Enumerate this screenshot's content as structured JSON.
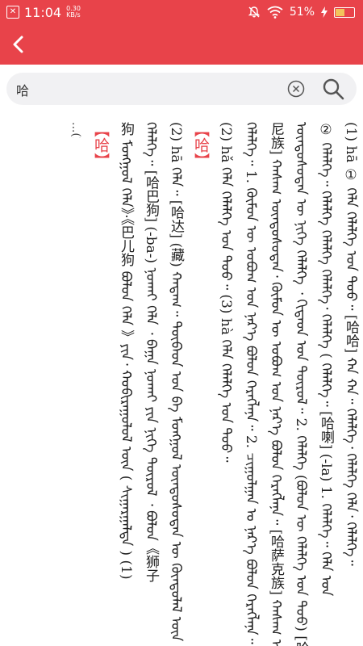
{
  "status_bar": {
    "time": "11:04",
    "net_speed_value": "0.30",
    "net_speed_unit": "KB/s",
    "battery": "51%",
    "battery_level": 0.51
  },
  "search": {
    "query": "哈"
  },
  "content": {
    "partial_top_line": "...(2) ...",
    "sections": [
      {
        "headword": "【哈】",
        "lines": [
          "狗 ᠮᠣᠩᠭᠤᠯ ᠬᠡᠯᠡ》·《巴儿狗 ᠪᠣᠯᠤᠨ ᠬᠡᠯᠡ 》ᠶᠢᠨ᠂ ᠬᠣᠪᠢᠷᠠᠭᠤᠯᠤᠯ ᠦᠨ ( ᠰᠢᠭᠠᠷᠭᠠᠯᠲᠠ ) ᠌(1)",
          "ᠬᠡᠯᠡᠯᠭᠡ᠃ [哈巴狗] (-ba-) ᠨᠣᠬᠠᠢ ᠬᠡᠯᠡ ᠂ ᠪᠠᠭᠠ ᠨᠣᠬᠠᠢ ᠶᠢᠨ ᠨᠢᠭᠡ ᠲᠦᠷᠦᠯ ᠂ ᠪᠣᠯᠤᠨ《狮子",
          "(2) hā ᠬᠡᠯᠡ᠃ [哈达] (藏) ᠬᠠᠳᠠᠭ᠃ ᠲᠦᠪᠡᠳ ᠤᠨ ᠪᠠ ᠮᠣᠩᠭᠤᠯ ᠦᠨᠳᠦᠰᠦᠲᠡᠨ ᠦ ᠬᠦᠨᠳᠦᠯᠡᠯ ᠦᠨ"
        ]
      },
      {
        "headword": "【哈】",
        "lines": [
          "(2) hǎ ᠬᠡᠯᠡ ᠬᠡᠯᠡᠯᠭᠡ ᠤᠨ ᠳᠤᠤ᠃ (3) hà ᠬᠡᠯᠡ ᠬᠡᠯᠡᠯᠭᠡ ᠤᠨ ᠳᠤᠤ᠃",
          "ᠬᠡᠯᠡᠯᠭᠡ᠃ 1. ᠬᠦᠮᠦᠨ ᠦ ᠣᠪᠣᠭ ᠤᠨ ᠨᠡᠷ᠎ᠡ ᠪᠣᠯᠤᠨ ᠬᠡᠷᠡᠭᠯᠡᠨᠡ᠃ 2. ᠴᠢᠭᠤᠯᠭᠠᠨ ᠤ ᠨᠡᠷ᠎ᠡ ᠪᠣᠯᠤᠨ ᠬᠡᠷᠡᠭᠯᠡᠨᠡ᠃",
          "尼族] ᠬᠠᠰᠠᠭ ᠦᠨᠳᠦᠰᠦᠲᠡᠨ᠂ ᠬᠦᠮᠦᠨ ᠦ ᠣᠪᠣᠭ ᠤᠨ ᠨᠡᠷ᠎ᠡ ᠪᠣᠯᠤᠨ ᠬᠡᠷᠡᠭᠯᠡᠨᠡ᠃ [哈萨克族] ᠬᠠᠰᠠᠭ ᠤᠨ",
          "ᠦᠨᠳᠦᠰᠦᠲᠡᠨ ᠦ ᠨᠢᠭᠡ ᠬᠡᠯᠡᠯᠭᠡ ᠂ ᠬᠢᠲᠠᠳ ᠤᠨ ᠲᠦᠷᠦᠯ᠃ 2. ᠬᠡᠯᠡᠯᠭᠡ (ᠪᠣᠯᠤᠨ ᠦ ᠬᠡᠯᠡᠯᠭᠡ ᠤᠨ ᠳᠤᠤ) [哈",
          "② ᠬᠡᠯᠡᠯᠭᠡ᠃ ᠬᠡᠯᠡᠯᠭᠡ ᠬᠡᠯᠡᠯᠭᠡ ᠬᠡᠯᠡᠯᠭᠡ᠂ ᠬᠡᠯᠡᠯᠭᠡ ( ᠬᠡᠯᠡᠯᠭᠡ᠃ [哈喇] (-la) 1. ᠬᠡᠯᠡᠯᠭᠡ᠃ ᠬᠡᠯᠡ ᠤᠨ",
          "(1) hā ① ᠬᠡᠯᠡ ᠬᠡᠯᠡᠯᠭᠡ ᠤᠨ ᠳᠤᠤ᠃ [哈哈] ᠬᠠ ᠬᠠ᠃ ᠬᠡᠯᠡᠯᠭᠡ᠂ ᠬᠡᠯᠡᠯᠭᠡ ᠬᠡᠯᠡ᠂ ᠬᠡᠯᠡᠯᠭᠡ᠃"
        ]
      }
    ]
  }
}
